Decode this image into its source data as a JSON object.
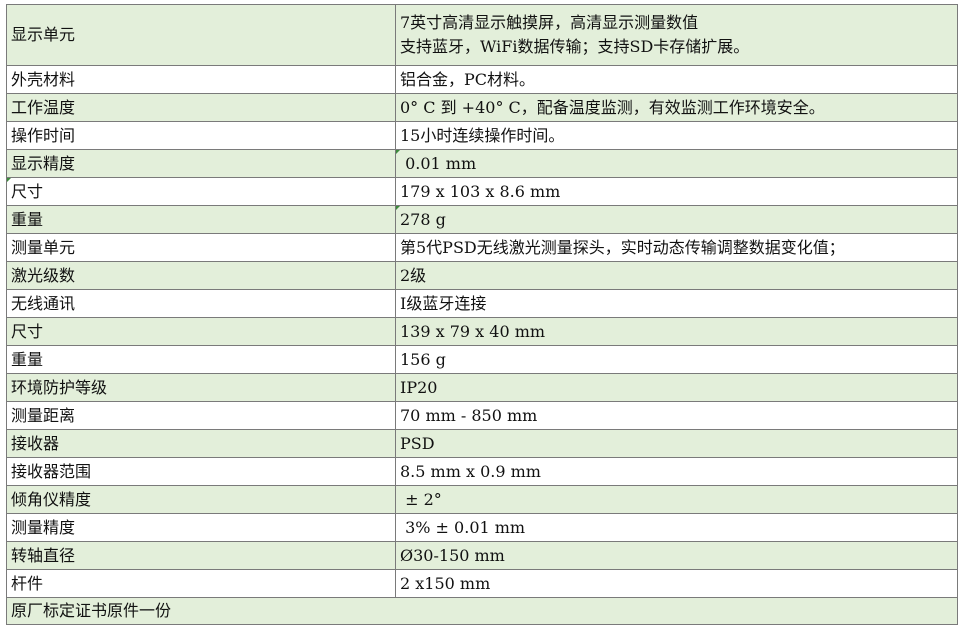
{
  "rows": [
    {
      "label": "显示单元",
      "value": [
        "7英寸高清显示触摸屏，高清显示测量数值",
        "支持蓝牙，WiFi数据传输；支持SD卡存储扩展。"
      ],
      "bg": "g"
    },
    {
      "label": "外壳材料",
      "value": "铝合金，PC材料。",
      "bg": "w"
    },
    {
      "label": "工作温度",
      "value": "0° C 到 +40° C，配备温度监测，有效监测工作环境安全。",
      "bg": "g"
    },
    {
      "label": "操作时间",
      "value": "15小时连续操作时间。",
      "bg": "w"
    },
    {
      "label": "显示精度",
      "value": " 0.01 mm",
      "bg": "g",
      "mark": true
    },
    {
      "label": "尺寸",
      "value": "179 x 103 x 8.6 mm",
      "bg": "w",
      "labelMark": true
    },
    {
      "label": "重量",
      "value": "278 g",
      "bg": "g",
      "mark": true
    },
    {
      "label": "测量单元",
      "value": "第5代PSD无线激光测量探头，实时动态传输调整数据变化值；",
      "bg": "w"
    },
    {
      "label": "激光级数",
      "value": "2级",
      "bg": "g"
    },
    {
      "label": "无线通讯",
      "value": "I级蓝牙连接",
      "bg": "w"
    },
    {
      "label": "尺寸",
      "value": "139 x 79 x 40 mm",
      "bg": "g"
    },
    {
      "label": "重量",
      "value": "156 g",
      "bg": "w"
    },
    {
      "label": "环境防护等级",
      "value": "IP20",
      "bg": "g"
    },
    {
      "label": "测量距离",
      "value": "70 mm - 850 mm",
      "bg": "w"
    },
    {
      "label": "接收器",
      "value": "PSD",
      "bg": "g"
    },
    {
      "label": "接收器范围",
      "value": "8.5 mm x 0.9 mm",
      "bg": "w"
    },
    {
      "label": "倾角仪精度",
      "value": " ± 2°",
      "bg": "g"
    },
    {
      "label": "测量精度",
      "value": " 3% ± 0.01 mm",
      "bg": "w"
    },
    {
      "label": "转轴直径",
      "value": "Ø30-150 mm",
      "bg": "g"
    },
    {
      "label": "杆件",
      "value": "2 x150 mm",
      "bg": "w"
    }
  ],
  "footer": {
    "text": "原厂标定证书原件一份",
    "bg": "g"
  }
}
